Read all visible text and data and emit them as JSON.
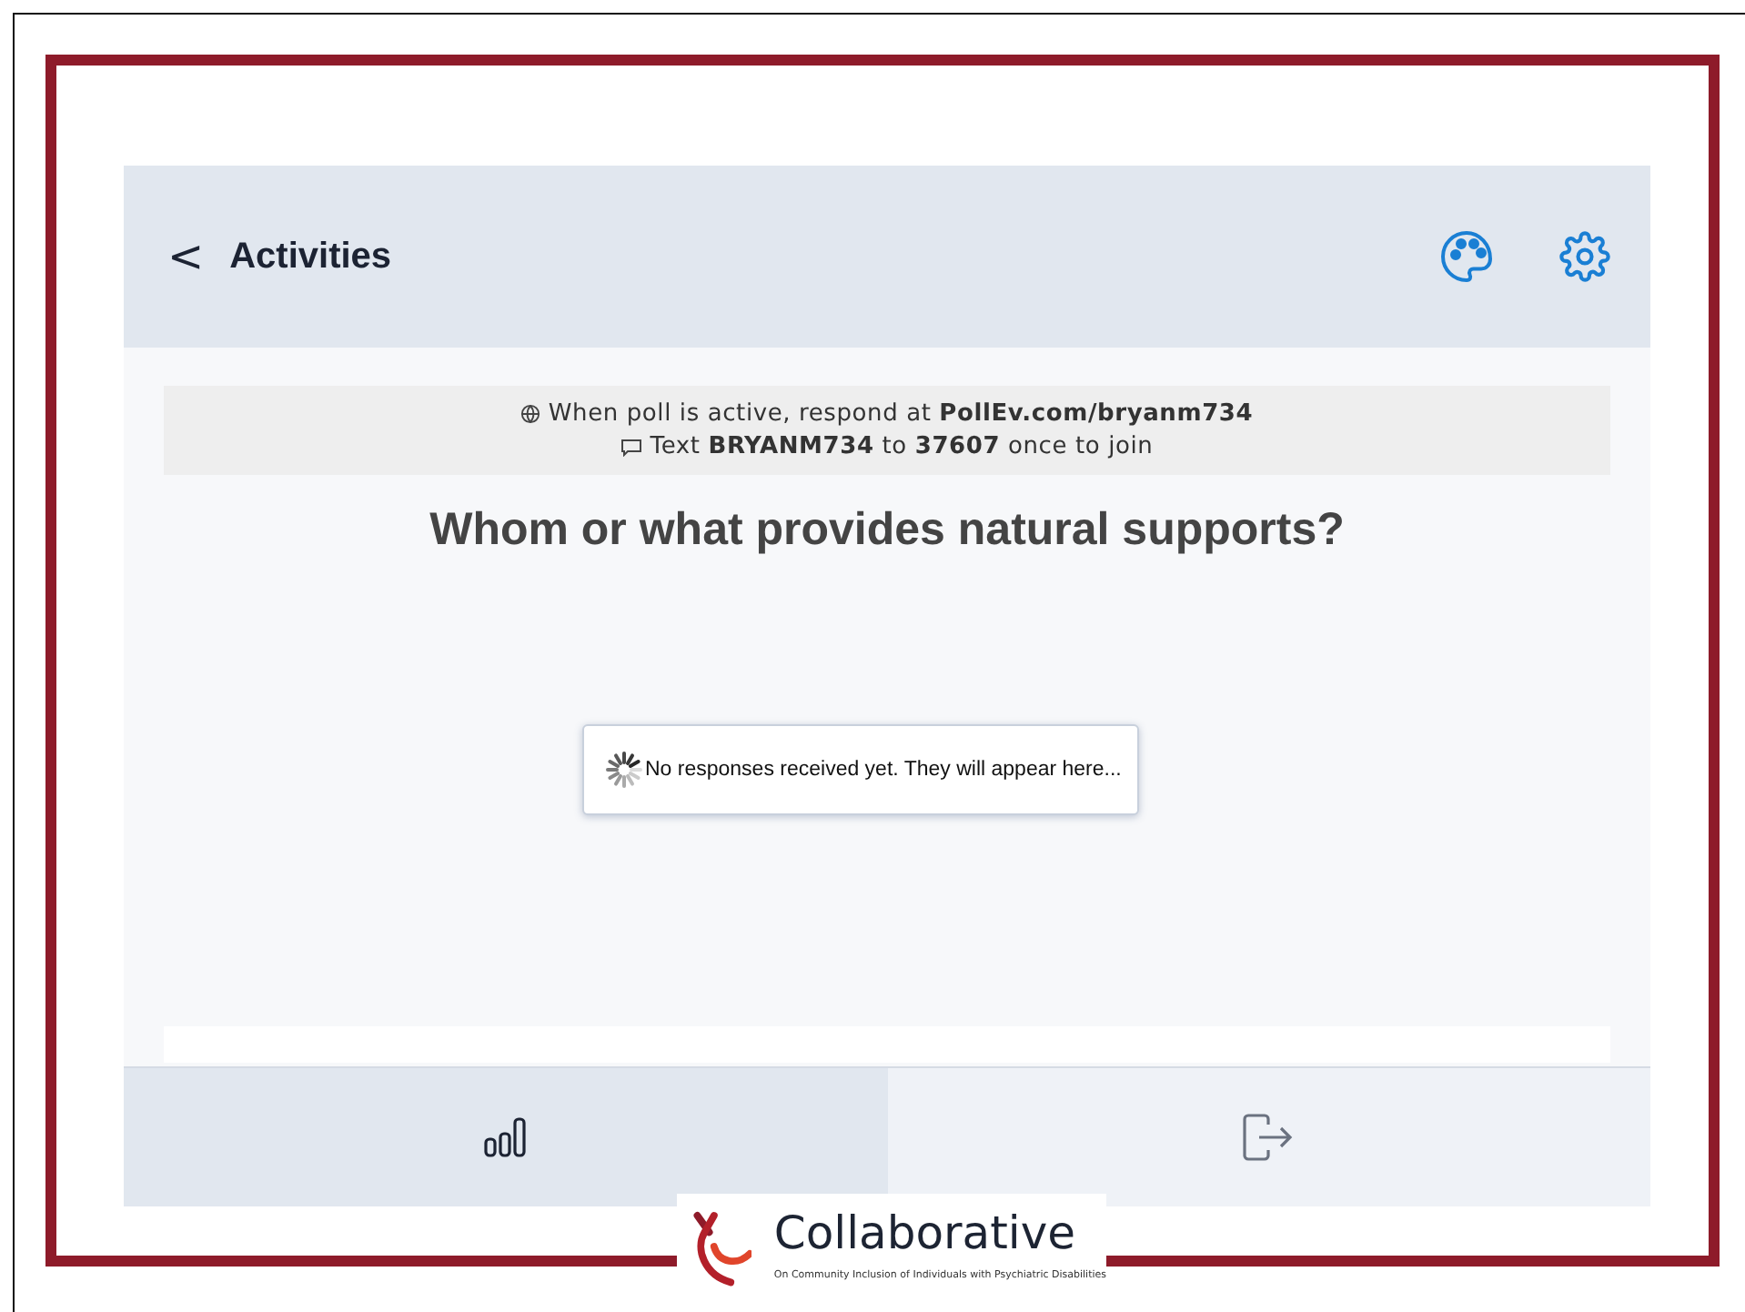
{
  "header": {
    "back": "<",
    "title": "Activities"
  },
  "banner": {
    "line1": "When poll is active, respond at **PollEv.com/bryanm734**",
    "line2": "Text **BRYANM734** to **37607** once to join"
  },
  "question": "Whom or what provides natural supports?",
  "status": "No responses received yet. They will appear here...",
  "tabs": [
    {
      "kind": "chart",
      "selected": true
    },
    {
      "kind": "exit",
      "selected": false
    }
  ],
  "logo": {
    "name": "Collaborative",
    "tagline": "On Community Inclusion of Individuals with Psychiatric Disabilities"
  }
}
